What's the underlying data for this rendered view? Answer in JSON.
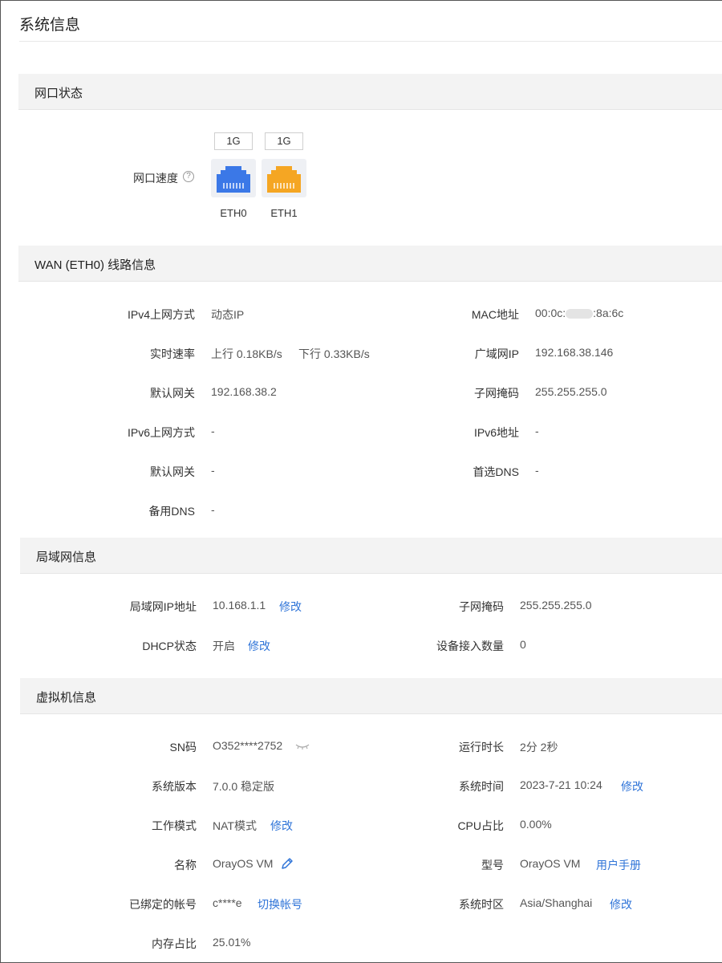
{
  "page": {
    "title": "系统信息"
  },
  "ports_section": {
    "title": "网口状态",
    "speed_label": "网口速度",
    "help_glyph": "?",
    "ports": [
      {
        "speed": "1G",
        "name": "ETH0",
        "color": "#3b78e7"
      },
      {
        "speed": "1G",
        "name": "ETH1",
        "color": "#f5a623"
      }
    ]
  },
  "wan": {
    "title": "WAN (ETH0) 线路信息",
    "ipv4_mode_label": "IPv4上网方式",
    "ipv4_mode": "动态IP",
    "mac_label": "MAC地址",
    "mac_prefix": "00:0c:",
    "mac_suffix": ":8a:6c",
    "rate_label": "实时速率",
    "rate_up": "上行 0.18KB/s",
    "rate_down": "下行 0.33KB/s",
    "wan_ip_label": "广域网IP",
    "wan_ip": "192.168.38.146",
    "gateway_label": "默认网关",
    "gateway": "192.168.38.2",
    "mask_label": "子网掩码",
    "mask": "255.255.255.0",
    "ipv6_mode_label": "IPv6上网方式",
    "ipv6_mode": "-",
    "ipv6_addr_label": "IPv6地址",
    "ipv6_addr": "-",
    "gateway6_label": "默认网关",
    "gateway6": "-",
    "dns1_label": "首选DNS",
    "dns1": "-",
    "dns2_label": "备用DNS",
    "dns2": "-"
  },
  "lan": {
    "title": "局域网信息",
    "ip_label": "局域网IP地址",
    "ip": "10.168.1.1",
    "ip_edit": "修改",
    "mask_label": "子网掩码",
    "mask": "255.255.255.0",
    "dhcp_label": "DHCP状态",
    "dhcp": "开启",
    "dhcp_edit": "修改",
    "devices_label": "设备接入数量",
    "devices": "0"
  },
  "vm": {
    "title": "虚拟机信息",
    "sn_label": "SN码",
    "sn": "O352****2752",
    "uptime_label": "运行时长",
    "uptime": "2分 2秒",
    "version_label": "系统版本",
    "version": "7.0.0 稳定版",
    "systime_label": "系统时间",
    "systime": "2023-7-21 10:24",
    "systime_edit": "修改",
    "mode_label": "工作模式",
    "mode": "NAT模式",
    "mode_edit": "修改",
    "cpu_label": "CPU占比",
    "cpu": "0.00%",
    "name_label": "名称",
    "name": "OrayOS VM",
    "model_label": "型号",
    "model": "OrayOS VM",
    "manual_link": "用户手册",
    "account_label": "已绑定的帐号",
    "account": "c****e",
    "account_switch": "切换帐号",
    "timezone_label": "系统时区",
    "timezone": "Asia/Shanghai",
    "timezone_edit": "修改",
    "memory_label": "内存占比",
    "memory": "25.01%"
  }
}
